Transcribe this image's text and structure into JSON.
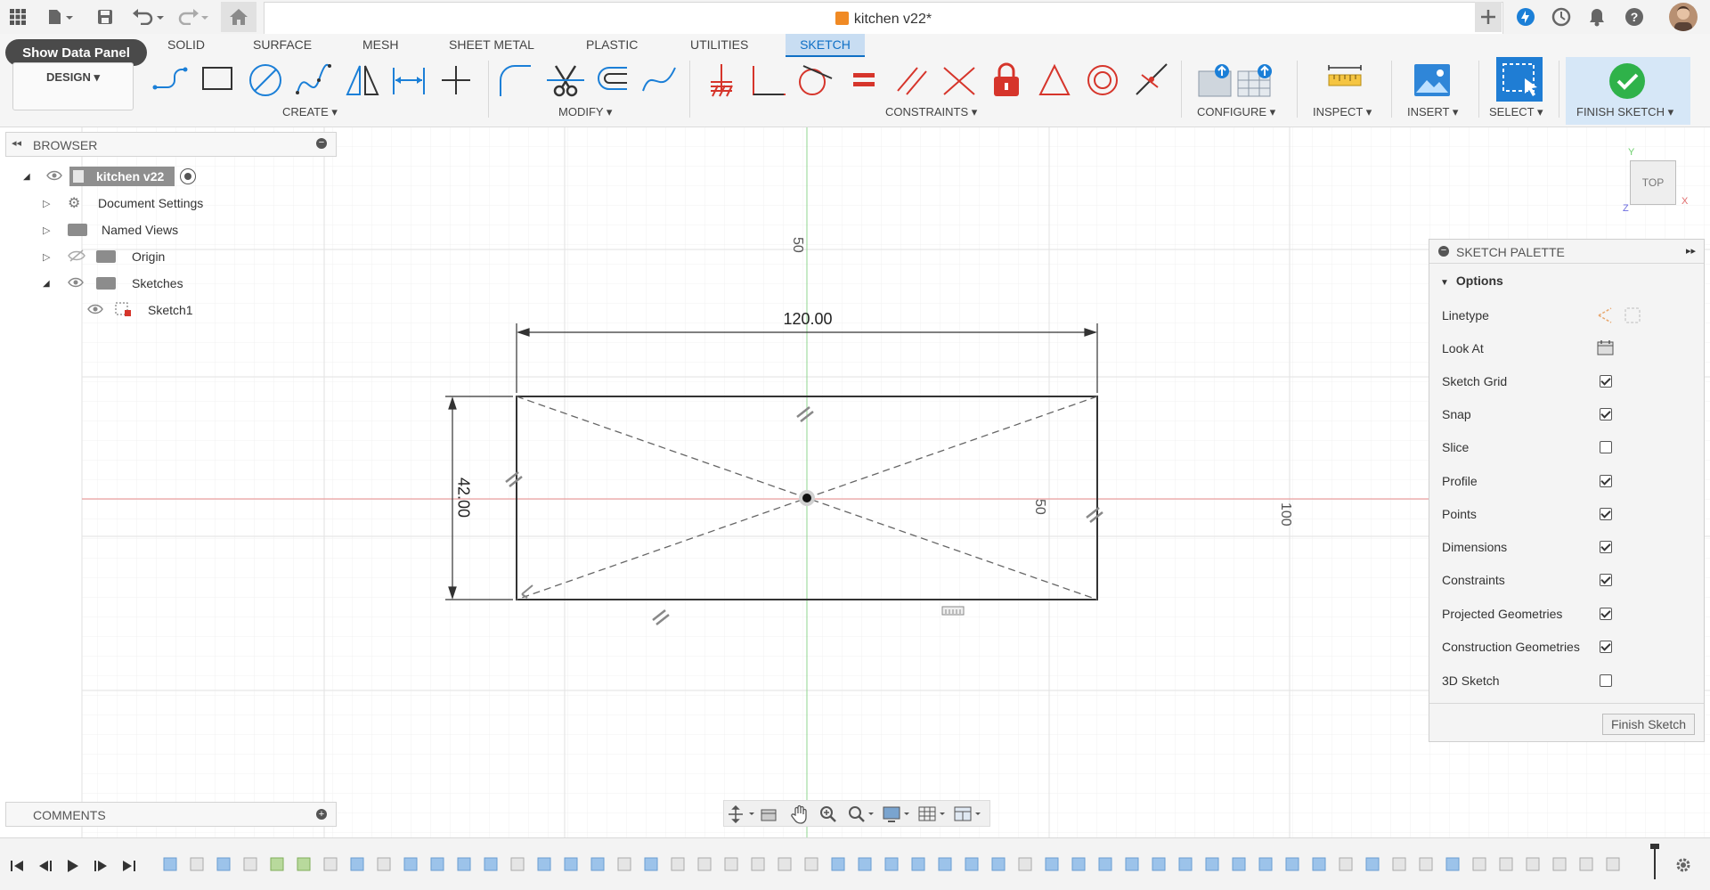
{
  "title_bar": {
    "doc_title": "kitchen v22*",
    "icons": [
      "apps-grid-icon",
      "file-icon",
      "save-icon",
      "undo-icon",
      "redo-icon",
      "home-icon",
      "close-icon",
      "add-tab-icon",
      "extensions-icon",
      "job-status-icon",
      "notifications-icon",
      "help-icon",
      "user-avatar"
    ]
  },
  "ribbon": {
    "show_data_panel": "Show Data Panel",
    "workspace": "DESIGN ▾",
    "tabs": [
      "SOLID",
      "SURFACE",
      "MESH",
      "SHEET METAL",
      "PLASTIC",
      "UTILITIES",
      "SKETCH"
    ],
    "groups": {
      "create": "CREATE ▾",
      "modify": "MODIFY ▾",
      "constraints": "CONSTRAINTS ▾",
      "configure": "CONFIGURE ▾",
      "inspect": "INSPECT ▾",
      "insert": "INSERT ▾",
      "select": "SELECT ▾",
      "finish": "FINISH SKETCH ▾"
    }
  },
  "browser": {
    "title": "BROWSER",
    "root": "kitchen v22",
    "items": [
      "Document Settings",
      "Named Views",
      "Origin",
      "Sketches",
      "Sketch1"
    ]
  },
  "canvas": {
    "dim_width": "120.00",
    "dim_height": "42.00",
    "grid_labels": [
      "50",
      "50",
      "100"
    ],
    "viewcube": "TOP",
    "axis_x": "X",
    "axis_y": "Y",
    "axis_z": "Z"
  },
  "palette": {
    "title": "SKETCH PALETTE",
    "section": "Options",
    "rows": [
      {
        "label": "Linetype",
        "kind": "icon"
      },
      {
        "label": "Look At",
        "kind": "icon"
      },
      {
        "label": "Sketch Grid",
        "kind": "check",
        "checked": true
      },
      {
        "label": "Snap",
        "kind": "check",
        "checked": true
      },
      {
        "label": "Slice",
        "kind": "check",
        "checked": false
      },
      {
        "label": "Profile",
        "kind": "check",
        "checked": true
      },
      {
        "label": "Points",
        "kind": "check",
        "checked": true
      },
      {
        "label": "Dimensions",
        "kind": "check",
        "checked": true
      },
      {
        "label": "Constraints",
        "kind": "check",
        "checked": true
      },
      {
        "label": "Projected Geometries",
        "kind": "check",
        "checked": true
      },
      {
        "label": "Construction Geometries",
        "kind": "check",
        "checked": true
      },
      {
        "label": "3D Sketch",
        "kind": "check",
        "checked": false
      }
    ],
    "finish_button": "Finish Sketch"
  },
  "comments": {
    "title": "COMMENTS"
  },
  "colors": {
    "accent": "#0e6fc5",
    "finish_green": "#2fb24a",
    "sketch_tab_bg": "#c8ddf2",
    "constraint_red": "#d6352b"
  }
}
